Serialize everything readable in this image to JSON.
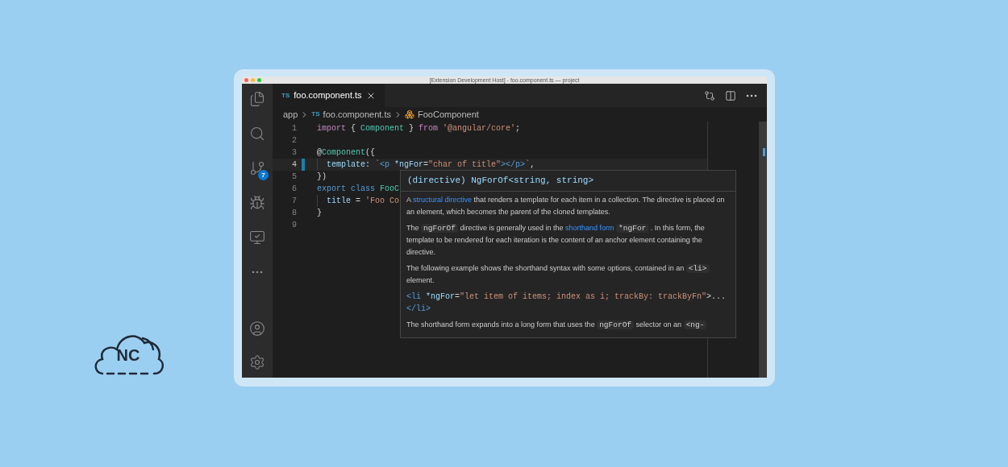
{
  "logo": {
    "text": "NC"
  },
  "window": {
    "title": "[Extension Development Host] - foo.component.ts — project"
  },
  "activity_bar": {
    "items": [
      {
        "kind": "files",
        "selected": false
      },
      {
        "kind": "search",
        "selected": false
      },
      {
        "kind": "source-control",
        "selected": false,
        "badge": "7"
      },
      {
        "kind": "run-debug",
        "selected": false
      },
      {
        "kind": "remote",
        "selected": false
      },
      {
        "kind": "more",
        "selected": false
      }
    ],
    "bottom_items": [
      {
        "kind": "account"
      },
      {
        "kind": "settings"
      }
    ]
  },
  "tabs": [
    {
      "badge": "TS",
      "label": "foo.component.ts",
      "selected": true
    }
  ],
  "editor_actions": [
    {
      "kind": "compare"
    },
    {
      "kind": "split"
    },
    {
      "kind": "more"
    }
  ],
  "breadcrumb": [
    {
      "kind": "folder",
      "label": "app"
    },
    {
      "kind": "file",
      "badge": "TS",
      "label": "foo.component.ts"
    },
    {
      "kind": "class",
      "label": "FooComponent"
    }
  ],
  "code": {
    "lines": [
      {
        "number": "1",
        "current": false,
        "indented": false,
        "tokens": [
          {
            "kind": "keyword",
            "text": "import "
          },
          {
            "kind": "plain",
            "text": "{ "
          },
          {
            "kind": "type",
            "text": "Component "
          },
          {
            "kind": "plain",
            "text": "} "
          },
          {
            "kind": "keyword",
            "text": "from "
          },
          {
            "kind": "string",
            "text": "'@angular/core'"
          },
          {
            "kind": "plain",
            "text": ";"
          }
        ]
      },
      {
        "number": "2",
        "current": false,
        "indented": false
      },
      {
        "number": "3",
        "current": false,
        "indented": false,
        "tokens": [
          {
            "kind": "plain",
            "text": "@"
          },
          {
            "kind": "type",
            "text": "Component"
          },
          {
            "kind": "plain",
            "text": "({"
          }
        ]
      },
      {
        "number": "4",
        "current": true,
        "indented": true,
        "tokens": [
          {
            "kind": "property",
            "text": "template"
          },
          {
            "kind": "plain",
            "text": ": "
          },
          {
            "kind": "string",
            "text": "`"
          },
          {
            "kind": "tag",
            "text": "<p "
          },
          {
            "kind": "property",
            "text": "*ngFor"
          },
          {
            "kind": "plain",
            "text": "="
          },
          {
            "kind": "string",
            "text": "\"char of title\""
          },
          {
            "kind": "tag",
            "text": "></p>"
          },
          {
            "kind": "string",
            "text": "`"
          },
          {
            "kind": "plain",
            "text": ","
          }
        ]
      },
      {
        "number": "5",
        "current": false,
        "indented": false,
        "tokens": [
          {
            "kind": "plain",
            "text": "})"
          }
        ]
      },
      {
        "number": "6",
        "current": false,
        "indented": false,
        "tokens": [
          {
            "kind": "storage",
            "text": "export class "
          },
          {
            "kind": "type",
            "text": "FooC"
          }
        ]
      },
      {
        "number": "7",
        "current": false,
        "indented": true,
        "tokens": [
          {
            "kind": "property",
            "text": "title "
          },
          {
            "kind": "plain",
            "text": "= "
          },
          {
            "kind": "string",
            "text": "'Foo Co"
          }
        ]
      },
      {
        "number": "8",
        "current": false,
        "indented": false,
        "tokens": [
          {
            "kind": "plain",
            "text": "}"
          }
        ]
      },
      {
        "number": "9",
        "current": false,
        "indented": false
      }
    ]
  },
  "hover": {
    "signature": "(directive) NgForOf<string, string>",
    "blocks": [
      {
        "kind": "paragraph",
        "segments": [
          {
            "kind": "text",
            "text": "A"
          },
          {
            "kind": "link",
            "text": "structural directive"
          },
          {
            "kind": "text",
            "text": "that renders a template for each item in a collection. The directive is placed on an element, which becomes the parent of the cloned templates."
          }
        ]
      },
      {
        "kind": "paragraph",
        "segments": [
          {
            "kind": "text",
            "text": "The"
          },
          {
            "kind": "code",
            "text": "ngForOf"
          },
          {
            "kind": "text",
            "text": "directive is generally used in the"
          },
          {
            "kind": "link",
            "text": "shorthand form"
          },
          {
            "kind": "code",
            "text": "*ngFor"
          },
          {
            "kind": "text",
            "text": ". In this form, the template to be rendered for each iteration is the content of an anchor element containing the directive."
          }
        ]
      },
      {
        "kind": "paragraph",
        "segments": [
          {
            "kind": "text",
            "text": "The following example shows the shorthand syntax with some options, contained in an"
          },
          {
            "kind": "code",
            "text": "<li>"
          },
          {
            "kind": "text",
            "text": "element."
          }
        ]
      },
      {
        "kind": "codeblock",
        "tokens": [
          {
            "kind": "tag",
            "text": "<li "
          },
          {
            "kind": "property",
            "text": "*ngFor"
          },
          {
            "kind": "plain",
            "text": "="
          },
          {
            "kind": "string",
            "text": "\"let item of items; index as i; trackBy: trackByFn\""
          },
          {
            "kind": "plain",
            "text": ">..."
          },
          {
            "kind": "tag",
            "text": "</li>"
          }
        ]
      },
      {
        "kind": "paragraph",
        "segments": [
          {
            "kind": "text",
            "text": "The shorthand form expands into a long form that uses the"
          },
          {
            "kind": "code",
            "text": "ngForOf"
          },
          {
            "kind": "text",
            "text": "selector on an"
          },
          {
            "kind": "code",
            "text": "<ng-"
          }
        ]
      }
    ]
  }
}
